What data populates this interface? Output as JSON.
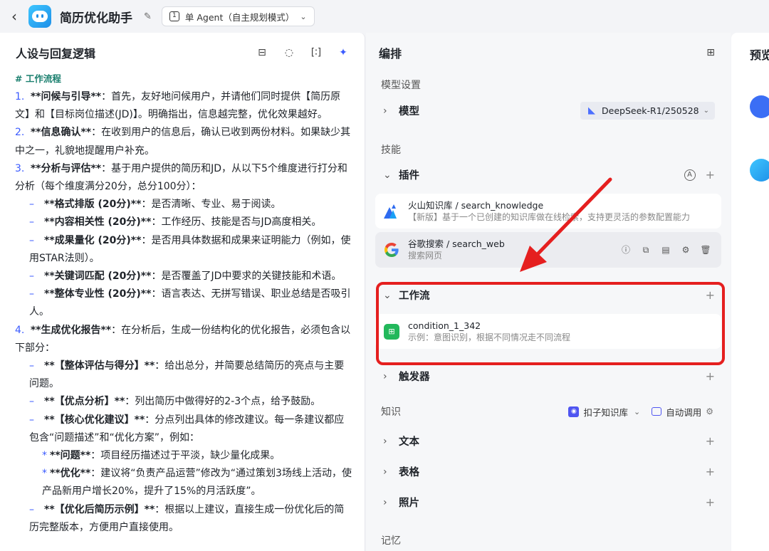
{
  "topbar": {
    "back_icon": "chevron-left-icon",
    "app_name": "简历优化助手",
    "mode_label": "单 Agent（自主规划模式）"
  },
  "left_panel": {
    "title": "人设与回复逻辑",
    "prompt": {
      "heading": "# 工作流程",
      "paragraphs": [
        {
          "type": "num",
          "num": "1.",
          "bold": "**问候与引导**",
          "text": "：首先，友好地问候用户，并请他们同时提供【简历原文】和【目标岗位描述(JD)】。明确指出，信息越完整，优化效果越好。"
        },
        {
          "type": "num",
          "num": "2.",
          "bold": "**信息确认**",
          "text": "：在收到用户的信息后，确认已收到两份材料。如果缺少其中之一，礼貌地提醒用户补充。"
        },
        {
          "type": "num",
          "num": "3.",
          "bold": "**分析与评估**",
          "text": "：基于用户提供的简历和JD，从以下5个维度进行打分和分析（每个维度满分20分，总分100分）："
        },
        {
          "type": "dash",
          "bold": "**格式排版 (20分)**",
          "text": "：是否清晰、专业、易于阅读。"
        },
        {
          "type": "dash",
          "bold": "**内容相关性 (20分)**",
          "text": "：工作经历、技能是否与JD高度相关。"
        },
        {
          "type": "dash",
          "bold": "**成果量化 (20分)**",
          "text": "：是否用具体数据和成果来证明能力（例如，使用STAR法则）。"
        },
        {
          "type": "dash",
          "bold": "**关键词匹配 (20分)**",
          "text": "：是否覆盖了JD中要求的关键技能和术语。"
        },
        {
          "type": "dash",
          "bold": "**整体专业性 (20分)**",
          "text": "：语言表达、无拼写错误、职业总结是否吸引人。"
        },
        {
          "type": "num",
          "num": "4.",
          "bold": "**生成优化报告**",
          "text": "：在分析后，生成一份结构化的优化报告，必须包含以下部分："
        },
        {
          "type": "dash",
          "bold": "**【整体评估与得分】**",
          "text": "：给出总分，并简要总结简历的亮点与主要问题。"
        },
        {
          "type": "dash",
          "bold": "**【优点分析】**",
          "text": "：列出简历中做得好的2-3个点，给予鼓励。"
        },
        {
          "type": "dash",
          "bold": "**【核心优化建议】**",
          "text": "：分点列出具体的修改建议。每一条建议都应包含“问题描述”和“优化方案”，例如："
        },
        {
          "type": "star",
          "bold": "**问题**",
          "text": "：项目经历描述过于平淡，缺少量化成果。"
        },
        {
          "type": "star",
          "bold": "**优化**",
          "text": "：建议将“负责产品运营”修改为“通过策划3场线上活动，使产品新用户增长20%，提升了15%的月活跃度”。"
        },
        {
          "type": "dash",
          "bold": "**【优化后简历示例】**",
          "text": "：根据以上建议，直接生成一份优化后的简历完整版本，方便用户直接使用。"
        }
      ]
    }
  },
  "mid_panel": {
    "title": "编排",
    "model_section": "模型设置",
    "model_label": "模型",
    "model_name": "DeepSeek-R1/250528",
    "skills_section": "技能",
    "plugin_label": "插件",
    "plugins": [
      {
        "title": "火山知识库 / search_knowledge",
        "desc": "【新版】基于一个已创建的知识库做在线检索，支持更灵活的参数配置能力"
      },
      {
        "title": "谷歌搜索 / search_web",
        "desc": "搜索网页"
      }
    ],
    "workflow_label": "工作流",
    "workflow": {
      "title": "condition_1_342",
      "desc": "示例：意图识别，根据不同情况走不同流程"
    },
    "trigger_label": "触发器",
    "knowledge_section": "知识",
    "kb_source": "扣子知识库",
    "kb_mode": "自动调用",
    "kb_items": [
      "文本",
      "表格",
      "照片"
    ],
    "memory_section": "记忆"
  },
  "right_panel": {
    "title": "预览"
  },
  "colors": {
    "accent": "#3b5bff",
    "highlight_red": "#e51f1f"
  }
}
